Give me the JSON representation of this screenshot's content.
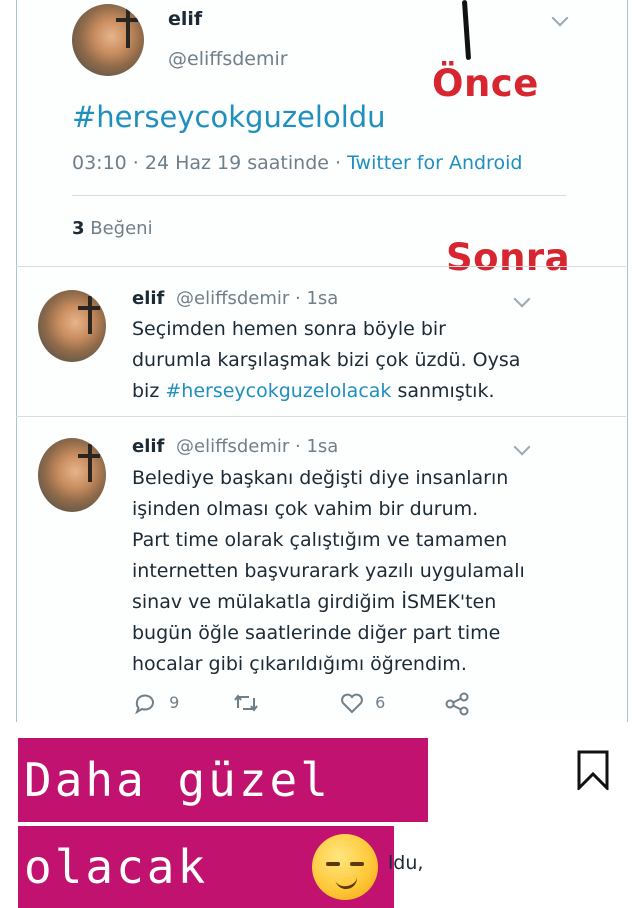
{
  "tweet": {
    "name": "elif",
    "handle": "@eliffsdemir",
    "hashtag": "#herseycokguzeloldu",
    "time": "03:10 · 24 Haz 19 saatinde · ",
    "source": "Twitter for Android",
    "likes_count": "3",
    "likes_label": " Beğeni"
  },
  "overlays": {
    "before": "Önce",
    "after": "Sonra"
  },
  "replies": [
    {
      "name": "elif",
      "handle": "@eliffsdemir · 1sa",
      "text_before": "Seçimden hemen sonra böyle bir\ndurumla karşılaşmak bizi çok üzdü. Oysa\nbiz ",
      "hashtag": "#herseycokguzelolacak",
      "text_after": " sanmıştık."
    },
    {
      "name": "elif",
      "handle": "@eliffsdemir · 1sa",
      "text": "Belediye başkanı değişti diye insanların\nişinden olması çok vahim bir durum.\nPart time olarak çalıştığım ve tamamen\ninternetten başvurarark yazılı uygulamalı\nsinav ve mülakatla girdiğim İSMEK'ten\nbugün öğle saatlerinde diğer part time\nhocalar gibi çıkarıldığımı öğrendim.",
      "reply_count": "9",
      "like_count": "6"
    }
  ],
  "story": {
    "line1": "Daha güzel",
    "line2": "olacak",
    "partial_text": "ldu,"
  },
  "colors": {
    "accent": "#1f8fbe",
    "overlay_red": "#d7262f",
    "banner": "#c0126e"
  },
  "icons": [
    "chevron-down-icon",
    "reply-icon",
    "retweet-icon",
    "heart-icon",
    "share-icon",
    "bookmark-icon",
    "smirk-emoji"
  ]
}
